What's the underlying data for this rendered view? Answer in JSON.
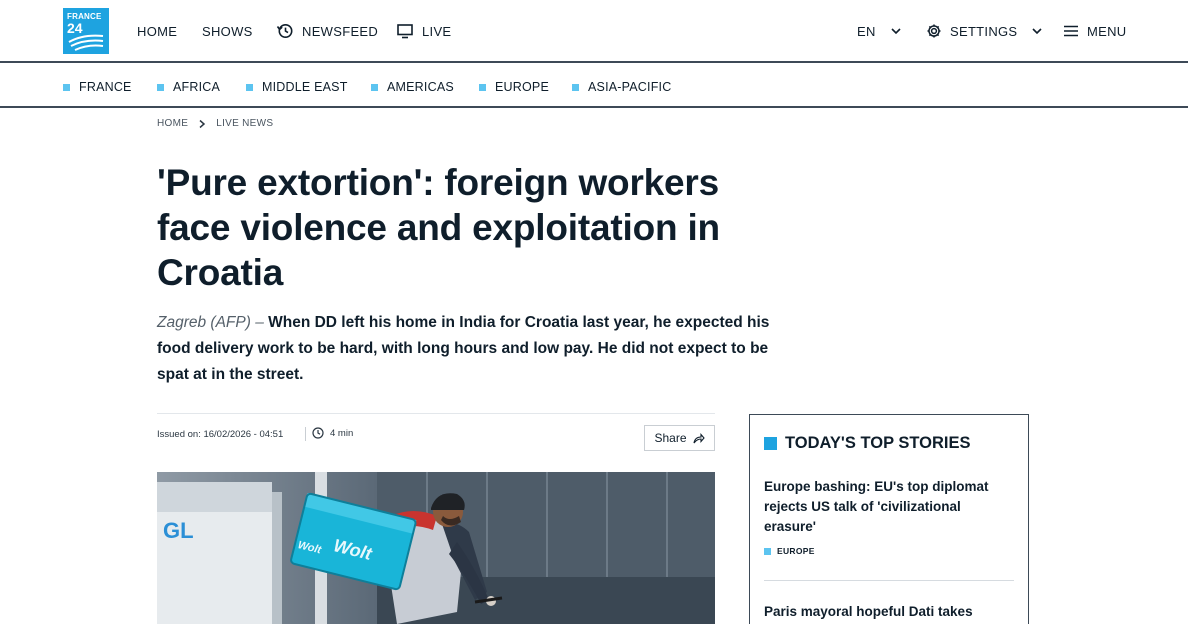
{
  "logo": {
    "line1": "FRANCE",
    "line2": "24"
  },
  "header": {
    "nav": [
      {
        "label": "HOME"
      },
      {
        "label": "SHOWS"
      },
      {
        "label": "NEWSFEED",
        "icon": "history-icon"
      },
      {
        "label": "LIVE",
        "icon": "tv-icon"
      }
    ],
    "language": "EN",
    "settings_label": "SETTINGS",
    "menu_label": "MENU"
  },
  "regions": [
    {
      "label": "FRANCE"
    },
    {
      "label": "AFRICA"
    },
    {
      "label": "MIDDLE EAST"
    },
    {
      "label": "AMERICAS"
    },
    {
      "label": "EUROPE"
    },
    {
      "label": "ASIA-PACIFIC"
    }
  ],
  "breadcrumb": {
    "home": "HOME",
    "current": "LIVE NEWS"
  },
  "article": {
    "headline": "'Pure extortion': foreign workers face violence and exploitation in Croatia",
    "dateline": "Zagreb (AFP) –",
    "lede": "When DD left his home in India for Croatia last year, he expected his food delivery work to be hard, with long hours and low pay. He did not expect to be spat at in the street.",
    "issued": "Issued on: 16/02/2026 - 04:51",
    "read_time": "4 min",
    "share_label": "Share",
    "photo_text": {
      "bag_brand": "Wolt",
      "van_text": "GL"
    }
  },
  "sidebar": {
    "title": "TODAY'S TOP STORIES",
    "stories": [
      {
        "title": "Europe bashing: EU's top diplomat rejects US talk of 'civilizational erasure'",
        "tag": "EUROPE"
      },
      {
        "title": "Paris mayoral hopeful Dati takes"
      }
    ]
  },
  "colors": {
    "brand": "#1ea3e0",
    "accent_light": "#5cc4f0",
    "ink": "#0f1e2b",
    "rule": "#3d4a57"
  }
}
